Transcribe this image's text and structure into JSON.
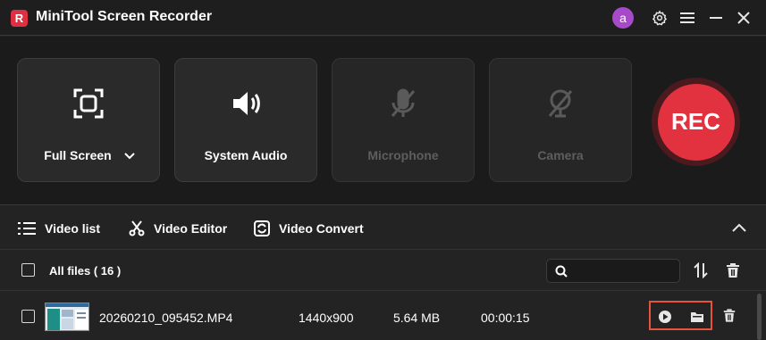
{
  "app": {
    "title": "MiniTool Screen Recorder",
    "logo_letter": "R",
    "avatar_letter": "a",
    "brand_color": "#e02e43"
  },
  "titlebar_icons": [
    "gear-icon",
    "menu-icon",
    "minimize-icon",
    "close-icon"
  ],
  "sources": [
    {
      "label": "Full Screen",
      "icon": "fullscreen-icon",
      "enabled": true,
      "has_dropdown": true
    },
    {
      "label": "System Audio",
      "icon": "speaker-icon",
      "enabled": true
    },
    {
      "label": "Microphone",
      "icon": "microphone-off-icon",
      "enabled": false
    },
    {
      "label": "Camera",
      "icon": "camera-off-icon",
      "enabled": false
    }
  ],
  "rec_button": {
    "label": "REC",
    "color": "#e3323f"
  },
  "tabs": [
    {
      "label": "Video list",
      "icon": "list-icon"
    },
    {
      "label": "Video Editor",
      "icon": "scissors-icon"
    },
    {
      "label": "Video Convert",
      "icon": "convert-icon"
    }
  ],
  "list_header": {
    "all_files_label": "All files ( 16 )",
    "search_placeholder": ""
  },
  "files": [
    {
      "name": "20260210_095452.MP4",
      "resolution": "1440x900",
      "size": "5.64 MB",
      "duration": "00:00:15"
    }
  ],
  "highlight_color": "#e5533d"
}
